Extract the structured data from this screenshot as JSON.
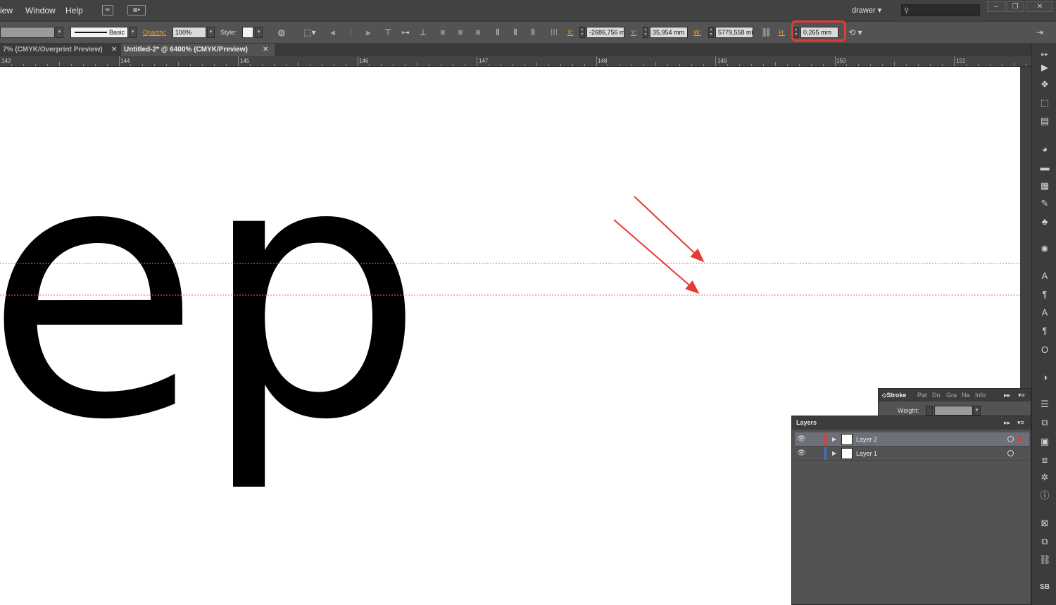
{
  "menu": {
    "items": [
      "View",
      "Window",
      "Help"
    ],
    "view_visible": "iew",
    "bridge_icon": "Br",
    "workspace": "drawer"
  },
  "control": {
    "stroke_style": "Basic",
    "opacity_label": "Opacity:",
    "opacity_value": "100%",
    "style_label": "Style:",
    "x_label": "X:",
    "x_value": "-2686,756 m",
    "y_label": "Y:",
    "y_value": "35,954 mm",
    "w_label": "W:",
    "w_value": "5779,558 mi",
    "h_label": "H:",
    "h_value": "0,265 mm"
  },
  "tabs": [
    {
      "label": "7% (CMYK/Overprint Preview)",
      "active": false
    },
    {
      "label": "Untitled-2* @ 6400% (CMYK/Preview)",
      "active": true
    }
  ],
  "ruler": {
    "labels": [
      "143",
      "144",
      "145",
      "146",
      "147",
      "148",
      "149",
      "150",
      "151"
    ]
  },
  "artwork": {
    "glyphs": "ep"
  },
  "stroke_panel": {
    "tabs": [
      "Stroke",
      "Pat",
      "Do",
      "Gra",
      "Na",
      "Info"
    ],
    "weight_label": "Weight:"
  },
  "layers_panel": {
    "title": "Layers",
    "layers": [
      {
        "name": "Layer 2",
        "color": "#e53935",
        "selected": true
      },
      {
        "name": "Layer 1",
        "color": "#3f6fd6",
        "selected": false
      }
    ]
  },
  "colors": {
    "highlight": "#e53935",
    "guide": "#f06a6a",
    "orange_label": "#f0a03c"
  }
}
